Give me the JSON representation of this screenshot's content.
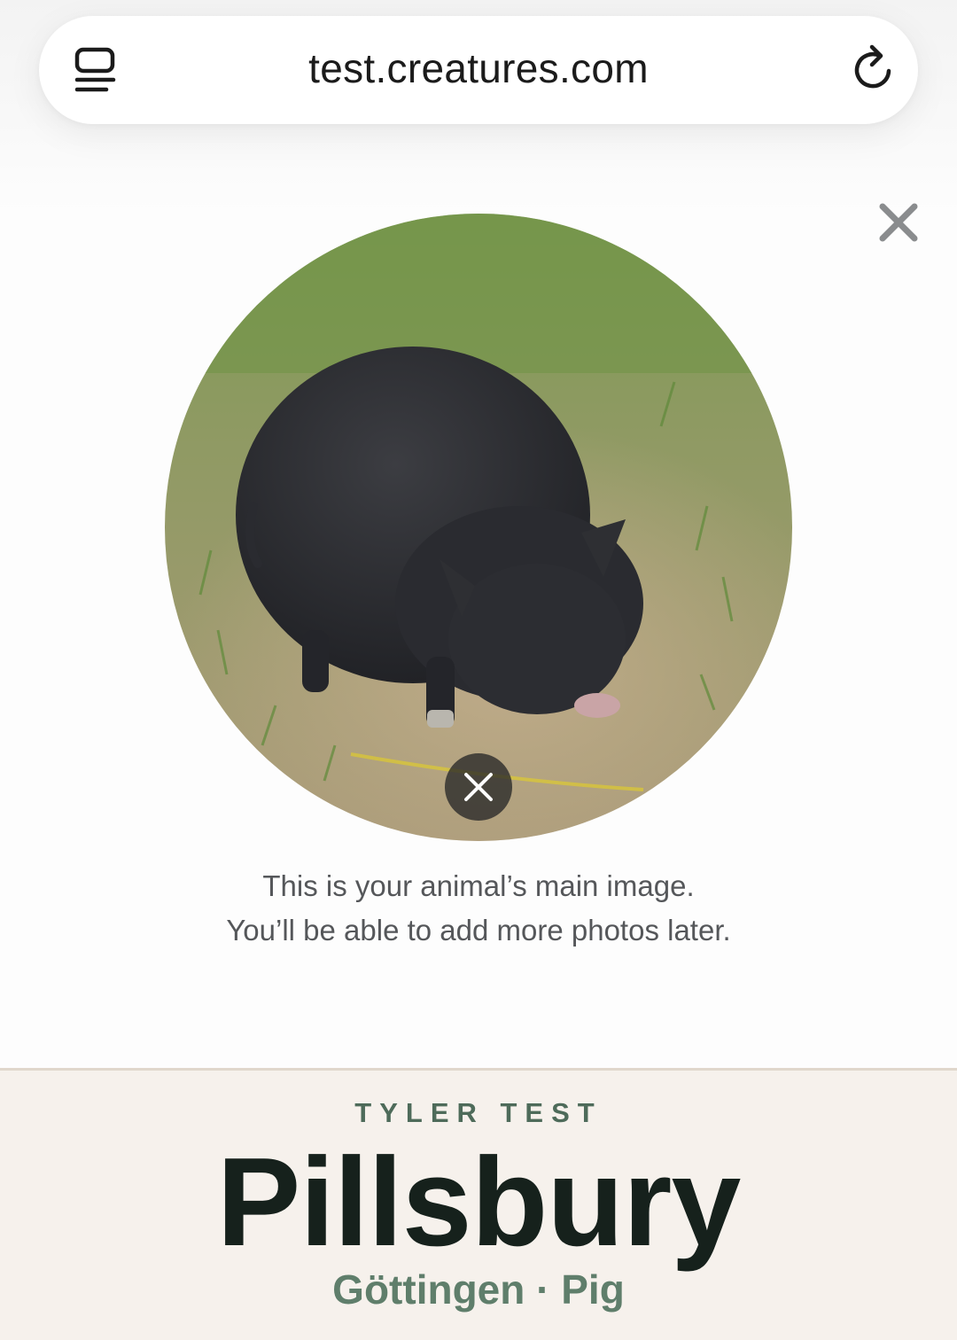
{
  "browser": {
    "url": "test.creatures.com",
    "tabs_icon": "tabs-list-icon",
    "reload_icon": "reload-icon"
  },
  "dialog": {
    "close_icon": "close-icon",
    "remove_photo_icon": "close-icon",
    "caption_line1": "This is your animal’s main image.",
    "caption_line2": "You’ll be able to add more photos later."
  },
  "animal": {
    "owner": "TYLER TEST",
    "name": "Pillsbury",
    "breed": "Göttingen",
    "separator": "·",
    "species": "Pig"
  },
  "colors": {
    "footer_bg": "#f6f1ec",
    "owner_text": "#4e6b5a",
    "name_text": "#16211c",
    "breed_text": "#5f7e6b"
  }
}
